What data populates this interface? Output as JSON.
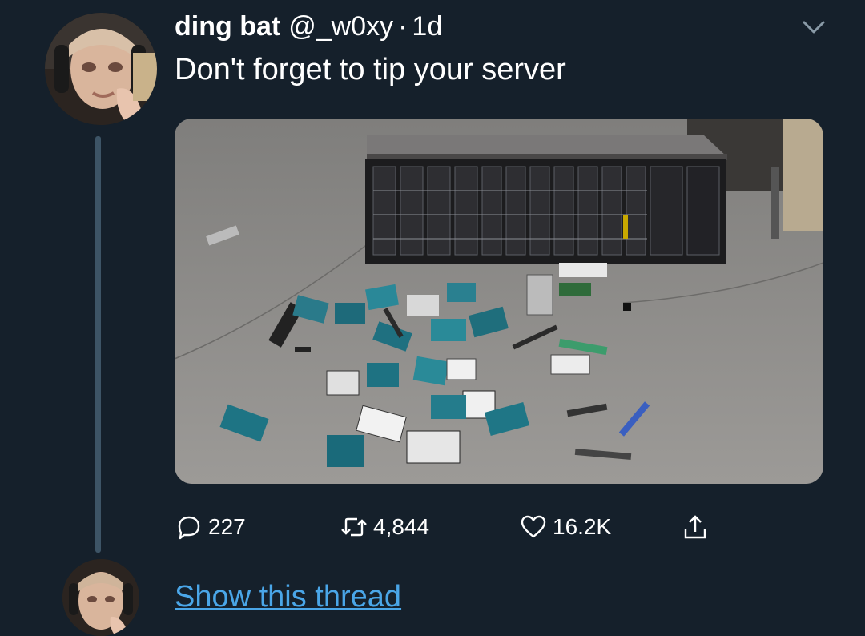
{
  "tweet": {
    "display_name": "ding bat",
    "handle": "@_w0xy",
    "separator": "·",
    "time": "1d",
    "text": "Don't forget to tip your server",
    "media_description": "Server rack on warehouse floor surrounded by scattered broken hard drives"
  },
  "actions": {
    "reply": {
      "icon": "reply-icon",
      "count": "227"
    },
    "retweet": {
      "icon": "retweet-icon",
      "count": "4,844"
    },
    "like": {
      "icon": "heart-icon",
      "count": "16.2K"
    },
    "share": {
      "icon": "share-icon"
    }
  },
  "thread": {
    "show_label": "Show this thread"
  },
  "colors": {
    "background": "#15202b",
    "text": "#ffffff",
    "link": "#4aa6e8",
    "thread_line": "#3d5466"
  }
}
